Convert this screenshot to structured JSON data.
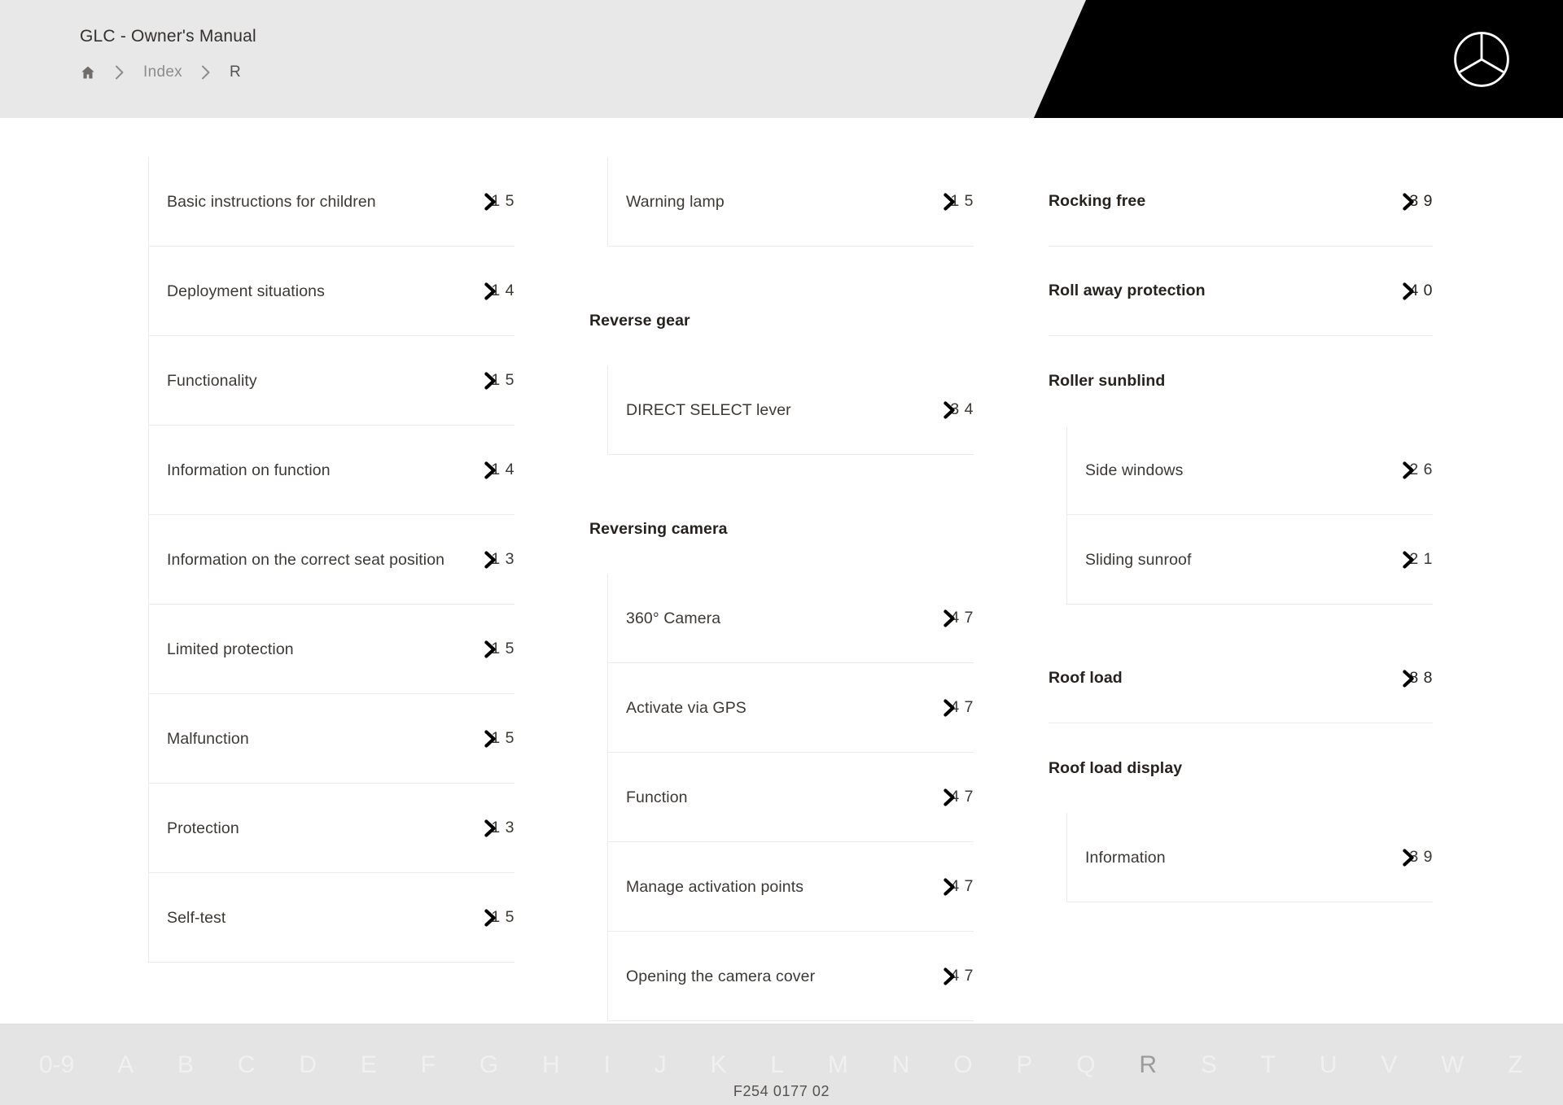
{
  "header": {
    "app_title": "GLC - Owner's Manual",
    "logo_icon": "mercedes-star-icon",
    "breadcrumb": {
      "home_icon": "home-icon",
      "separator_icon": "chevron-right-icon",
      "items": [
        {
          "label": "Index",
          "current": false
        },
        {
          "label": "R",
          "current": true
        }
      ]
    }
  },
  "index": {
    "page_ref_icon": "chevron-right-icon",
    "columns": [
      {
        "id": "column-1",
        "entries": [
          {
            "level": 2,
            "label": "Basic instructions for children",
            "page": "1 5"
          },
          {
            "level": 2,
            "label": "Deployment situations",
            "page": "1 4"
          },
          {
            "level": 2,
            "label": "Functionality",
            "page": "1 5"
          },
          {
            "level": 2,
            "label": "Information on function",
            "page": "1 4"
          },
          {
            "level": 2,
            "label": "Information on the correct seat posi­tion",
            "page": "1 3"
          },
          {
            "level": 2,
            "label": "Limited protection",
            "page": "1 5"
          },
          {
            "level": 2,
            "label": "Malfunction",
            "page": "1 5"
          },
          {
            "level": 2,
            "label": "Protection",
            "page": "1 3"
          },
          {
            "level": 2,
            "label": "Self-test",
            "page": "1 5"
          }
        ]
      },
      {
        "id": "column-2",
        "entries": [
          {
            "level": 2,
            "label": "Warning lamp",
            "page": "1 5"
          },
          {
            "level": 1,
            "label": "Reverse gear",
            "page": ""
          },
          {
            "level": 2,
            "label": "DIRECT SELECT lever",
            "page": "3 4"
          },
          {
            "level": 1,
            "label": "Reversing camera",
            "page": ""
          },
          {
            "level": 2,
            "label": "360° Camera",
            "page": "4 7"
          },
          {
            "level": 2,
            "label": "Activate via GPS",
            "page": "4 7"
          },
          {
            "level": 2,
            "label": "Function",
            "page": "4 7"
          },
          {
            "level": 2,
            "label": "Manage activation points",
            "page": "4 7"
          },
          {
            "level": 2,
            "label": "Opening the camera cover",
            "page": "4 7"
          }
        ]
      },
      {
        "id": "column-3",
        "entries": [
          {
            "level": 1,
            "label": "Rocking free",
            "page": "3 9"
          },
          {
            "level": 1,
            "label": "Roll away protection",
            "page": "4 0"
          },
          {
            "level": 1,
            "label": "Roller sunblind",
            "page": ""
          },
          {
            "level": 2,
            "label": "Side windows",
            "page": "2 6"
          },
          {
            "level": 2,
            "label": "Sliding sunroof",
            "page": "2 1"
          },
          {
            "level": 1,
            "label": "Roof load",
            "page": "8 8"
          },
          {
            "level": 1,
            "label": "Roof load display",
            "page": ""
          },
          {
            "level": 2,
            "label": "Information",
            "page": "3 9"
          }
        ]
      }
    ]
  },
  "alphabet_bar": {
    "active": "R",
    "items": [
      "0-9",
      "A",
      "B",
      "C",
      "D",
      "E",
      "F",
      "G",
      "H",
      "I",
      "J",
      "K",
      "L",
      "M",
      "N",
      "O",
      "P",
      "Q",
      "R",
      "S",
      "T",
      "U",
      "V",
      "W",
      "Z"
    ]
  },
  "footer": {
    "code": "F254 0177 02"
  }
}
